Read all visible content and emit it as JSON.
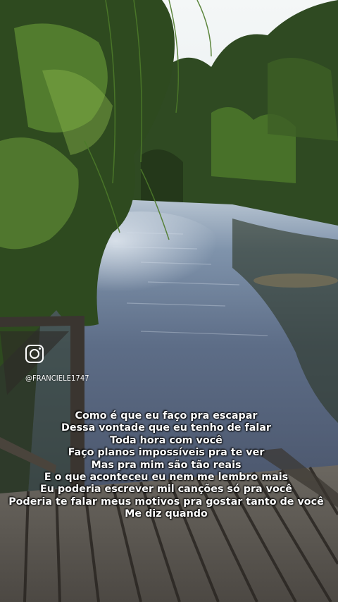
{
  "overlay": {
    "social_icon": "instagram-icon",
    "handle": "@FRANCIELE1747",
    "text_color": "#ffffff"
  },
  "lyrics": [
    "Como é que eu faço pra escapar",
    "Dessa vontade que eu tenho de falar",
    "Toda hora com você",
    "Faço planos impossíveis pra te ver",
    "Mas pra mim são tão reais",
    "E o que aconteceu eu nem me lembro mais",
    "Eu poderia escrever mil canções só pra você",
    "Poderia te falar meus motivos pra gostar tanto de você",
    "Me diz quando"
  ]
}
